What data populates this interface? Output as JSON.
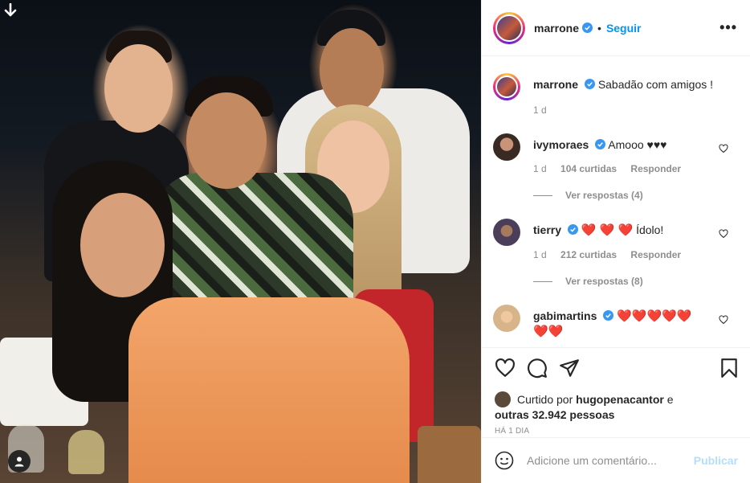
{
  "post": {
    "author": "marrone",
    "follow_label": "Seguir",
    "more_label": "•••"
  },
  "caption": {
    "author": "marrone",
    "text": "Sabadão com amigos !",
    "time": "1 d"
  },
  "comments": [
    {
      "user": "ivymoraes",
      "text": "Amooo ♥♥♥",
      "time": "1 d",
      "likes": "104 curtidas",
      "reply_label": "Responder",
      "view_replies": "Ver respostas (4)",
      "avatar_color": "#3a2a24"
    },
    {
      "user": "tierry",
      "hearts": "❤️ ❤️ ❤️",
      "text": "Ídolo!",
      "time": "1 d",
      "likes": "212 curtidas",
      "reply_label": "Responder",
      "view_replies": "Ver respostas (8)",
      "avatar_color": "#4a3e5a"
    },
    {
      "user": "gabimartins",
      "hearts": "❤️❤️❤️❤️❤️",
      "hearts2": "❤️❤️",
      "avatar_color": "#d8b48a"
    }
  ],
  "likes": {
    "prefix": "Curtido por",
    "user": "hugopenacantor",
    "suffix": "e",
    "others": "outras 32.942 pessoas"
  },
  "timestamp": "HÁ 1 DIA",
  "composer": {
    "placeholder": "Adicione um comentário...",
    "publish_label": "Publicar"
  },
  "colors": {
    "link_blue": "#0095f6",
    "publish_disabled": "#b2dffc",
    "verified_blue": "#3897f0",
    "heart_red": "#ed4956"
  },
  "icons": {
    "download": "arrow-down-icon",
    "tagged_user": "user-icon",
    "verified": "verified-badge-icon",
    "like": "heart-icon",
    "comment": "comment-icon",
    "share": "share-icon",
    "save": "bookmark-icon",
    "emoji": "emoji-icon"
  }
}
